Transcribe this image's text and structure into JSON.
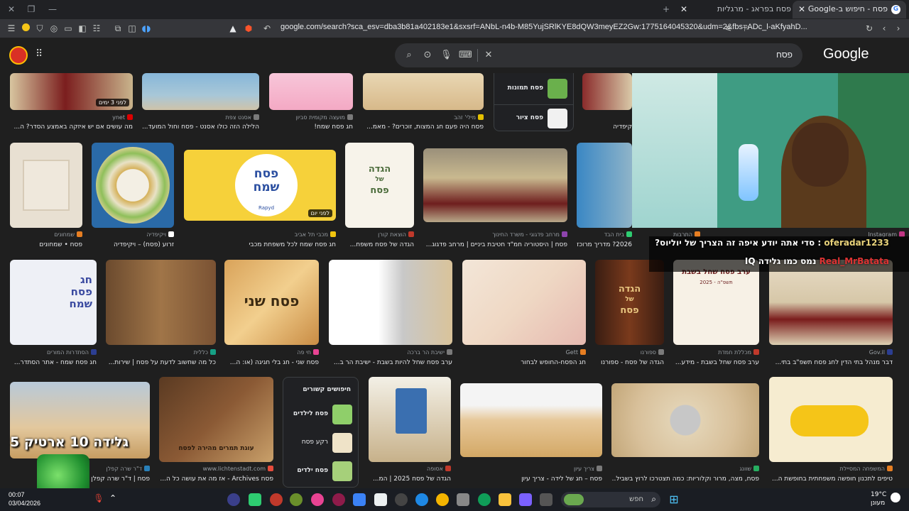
{
  "browser": {
    "tabs": [
      {
        "title": "פסח - חיפוש ב-Google",
        "active": true
      },
      {
        "title": "פסח בפראג - מרגליות",
        "active": false
      }
    ],
    "new_tab": "+",
    "url": "google.com/search?sca_esv=dba3b81a402183e1&sxsrf=ANbL-n4b-M85YujSRlKYE8dQW3meyEZ2Gw:1775164045320&udm=2&fbs=ADc_l-aKfyahD..."
  },
  "google": {
    "logo": "Google",
    "query": "פסח"
  },
  "row1": [
    {
      "source": "ynet",
      "title": "מה עושים אם יש איזקה באמצע הסדר? ה...",
      "badge": "לפני 3 ימים"
    },
    {
      "source": "אסנט צפת",
      "title": "הלילה הזה כולו אסנט - פסח וחול המועד..."
    },
    {
      "source": "מועצה מקומית סביון",
      "title": "חג פסח שמח!"
    },
    {
      "source": "מילי' זהב",
      "title": "פסח היה פעם חג המצות, זוכרים? - מאמ..."
    },
    {
      "source": "",
      "title": "קיפדיה"
    }
  ],
  "related_top": [
    {
      "label": "פסח תמונות"
    },
    {
      "label": "פסח ציור"
    }
  ],
  "row2": [
    {
      "source": "שמחונים",
      "title": "פסח • שמחונים"
    },
    {
      "source": "ויקיפדיה",
      "title": "זרוע (פסח) – ויקיפדיה"
    },
    {
      "source": "מכבי תל אביב",
      "title": "חג פסח שמח לכל משפחת מכבי",
      "badge": "לפני יום",
      "card_line1": "פסח",
      "card_line2": "שמח",
      "card_brand": "Rapyd"
    },
    {
      "source": "הוצאת קורן",
      "title": "הגדה של פסח משפח...",
      "card_line1": "הגדה",
      "card_line2": "של",
      "card_line3": "פסח"
    },
    {
      "source": "מרחב פדגוגי - משרד החינוך",
      "title": "פסח | היסטוריה חמ\"ד חטיבת ביניים | מרחב פדגוג..."
    },
    {
      "source": "בית הבד",
      "title": "2026? מדריך מרוכז, כולל..."
    }
  ],
  "row2_extra": [
    {
      "source": "התרבות"
    },
    {
      "source": "Instagram"
    }
  ],
  "row3": [
    {
      "source": "הסתדרות המורים",
      "title": "חג פסח שמח - אתר הסתדר...",
      "card_line1": "חג",
      "card_line2": "פסח",
      "card_line3": "שמח"
    },
    {
      "source": "כללית",
      "title": "כל מה שחשוב לדעת על פסח | שירות..."
    },
    {
      "source": "חי פה",
      "title": "פסח שני - חג בלי חגיגה (או: ה...",
      "card_text": "פסח שני"
    },
    {
      "source": "ישיבת הר ברכה",
      "title": "ערב פסח שחל להיות בשבת - ישיבת הר ב..."
    },
    {
      "source": "Gett",
      "title": "חג הפסח-החופש לבחור"
    },
    {
      "source": "ספורנו",
      "title": "הגדה של פסח - ספורנו",
      "card_line1": "הגדה",
      "card_line2": "של",
      "card_line3": "פסח"
    },
    {
      "source": "מכללת חמדת",
      "title": "ערב פסח שחל בשבת - מידע...",
      "card_line1": "ערב פסח שחל בשבת",
      "card_line2": "תשפ\"ה - 2025"
    },
    {
      "source": "Gov.il",
      "title": "דבר מנהל בתי הדין לחג פסח תשפ\"ב בתי..."
    }
  ],
  "related_bottom": {
    "heading": "חיפושים קשורים",
    "items": [
      {
        "label": "פסח לילדים"
      },
      {
        "label": "רקע פסח"
      },
      {
        "label": "פסח ילדים"
      }
    ]
  },
  "row4": [
    {
      "source": "ד\"ר שרה קפלן",
      "title": "פסח | ד\"ר שרה קפלן"
    },
    {
      "source": "www.lichtenstadt.com",
      "title": "פסח Archives - אז מה את עושה כל ה...",
      "card_text": "עוגת תמרים מהירה לפסח"
    },
    {
      "source": "אסופה",
      "title": "הגדה של פסח 2025 | המ..."
    },
    {
      "source": "צריך עיון",
      "title": "פסח – חג של לידה - צריך עיון"
    },
    {
      "source": "שוונג",
      "title": "פסח, מצה, מרור וקלוריות: כמה תצטרכו לרוץ בשביל..."
    },
    {
      "source": "המשפחה המסיילת",
      "title": "טיפים לתכנון חופשה משפחתית בחופשת ה..."
    }
  ],
  "stream": {
    "chat": [
      {
        "user": "oferadar1233",
        "message": "סדי אתה יודע איפה זה הצריך של יוליוס?"
      },
      {
        "user": "Real_MrBatata",
        "message": "נמס כמו גלידה IQ"
      }
    ],
    "overlay_text": "גלידה 10 ארטיק 5"
  },
  "taskbar": {
    "time": "00:07",
    "date": "03/04/2026",
    "search_placeholder": "חפש",
    "temp": "19°C",
    "weather": "מעונן"
  },
  "colors": {
    "background": "#1f1f1f",
    "search_bg": "#303134",
    "accent_green": "#3f9c83"
  }
}
